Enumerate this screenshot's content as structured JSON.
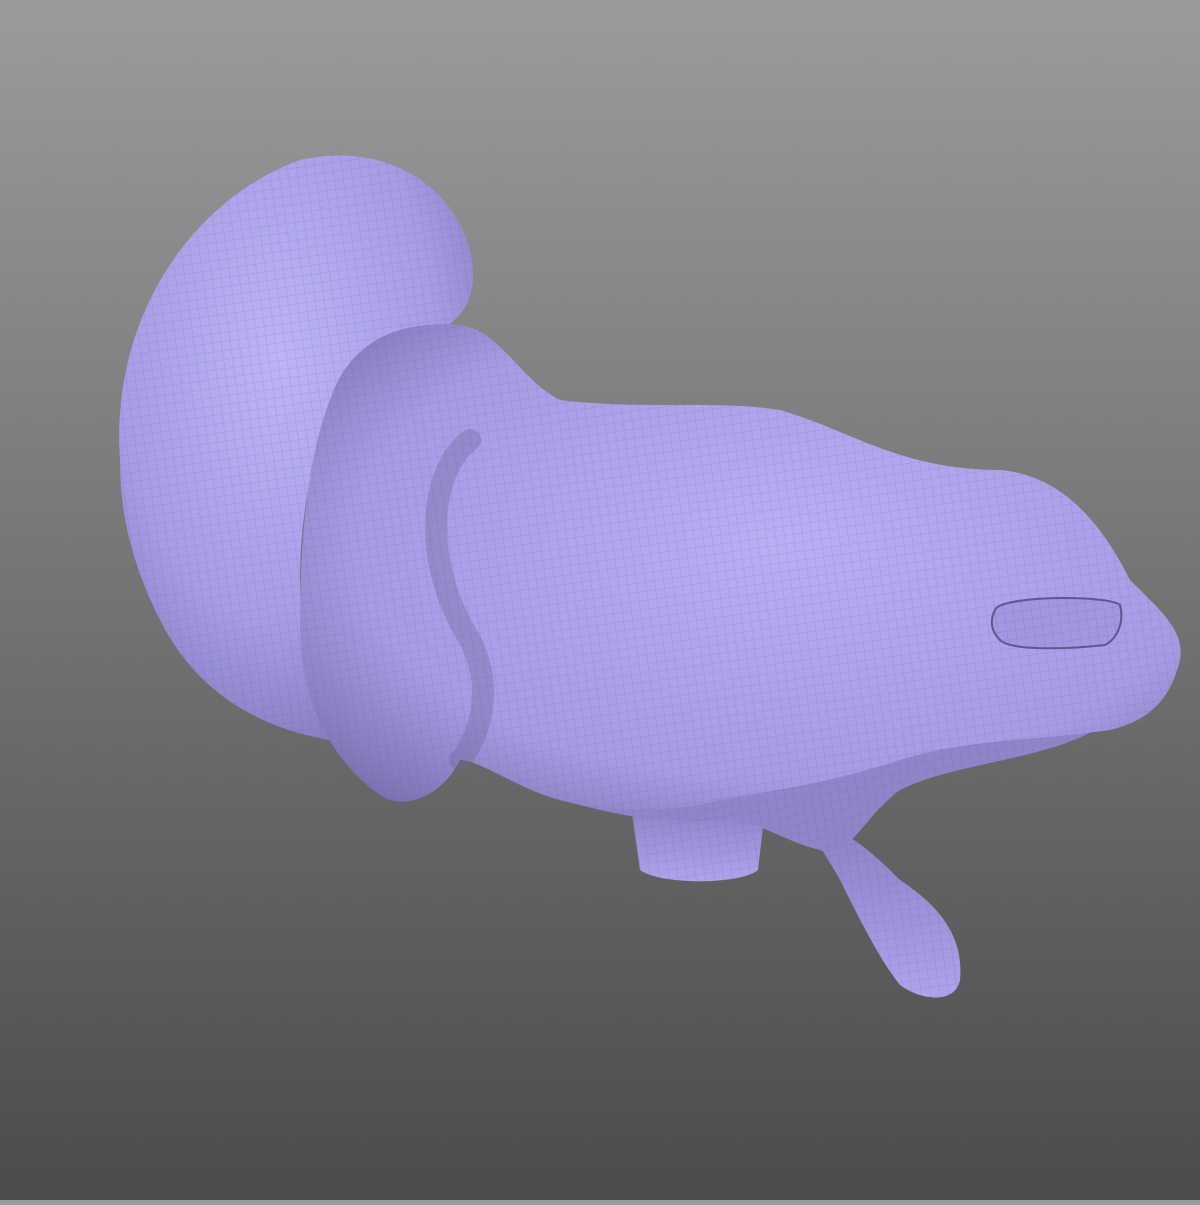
{
  "scene": {
    "model": "ear-mesh",
    "colors": {
      "background_top": "#9b9b9b",
      "background_bottom": "#4b4b4b",
      "mesh_base": "#b3a9f2",
      "mesh_shadow": "#6e6599",
      "wire": "#7c74b0"
    }
  }
}
